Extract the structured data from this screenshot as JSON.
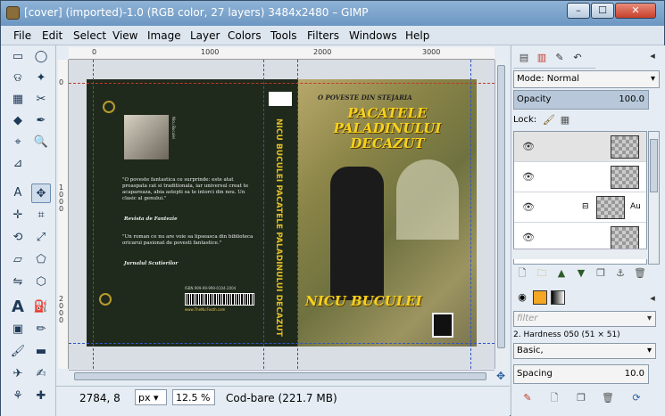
{
  "window": {
    "title": "[cover] (imported)-1.0 (RGB color, 27 layers) 3484x2480 – GIMP",
    "minimize_label": "–",
    "maximize_label": "☐",
    "close_label": "✕"
  },
  "menu": [
    "File",
    "Edit",
    "Select",
    "View",
    "Image",
    "Layer",
    "Colors",
    "Tools",
    "Filters",
    "Windows",
    "Help"
  ],
  "ruler": {
    "h_ticks": [
      "0",
      "1000",
      "2000",
      "3000"
    ],
    "v_ticks": [
      "0",
      "1000",
      "2000"
    ]
  },
  "cover": {
    "back_quote1": "\"O poveste fantastica ce surprinde: este atat proaspata cat si traditionala, iar universul creat te acapareaza, abia astepti sa te intorci din nou. Un clasic al genului.\"",
    "back_source1": "Revista de Fantezie",
    "back_quote2": "\"Un roman ce nu are voie sa lipseasca din biblioteca oricarui pasionat de povesti fantastice.\"",
    "back_source2": "Jurnalul Scutierilor",
    "photo_caption": "Nicu Buculei",
    "isbn": "ISBN 999-99-999-0104-2004",
    "barcode_caption": "www.TheNicFooth.com",
    "spine_title": "NICU BUCULEI   PACATELE PALADINULUI DECAZUT",
    "front_subtitle": "O POVESTE DIN STEJARIA",
    "front_title": "PACATELE PALADINULUI DECAZUT",
    "front_author": "NICU BUCULEI"
  },
  "status": {
    "coords": "2784, 8",
    "unit": "px",
    "zoom": "12.5 %",
    "message": "Cod-bare (221.7 MB)"
  },
  "layers_panel": {
    "mode_label": "Mode: Normal",
    "opacity_label": "Opacity",
    "opacity_value": "100.0",
    "lock_label": "Lock:",
    "layer_name_partial": "Au"
  },
  "brushes_panel": {
    "filter_placeholder": "filter",
    "brush_name": "2. Hardness 050 (51 × 51)",
    "preset": "Basic,",
    "spacing_label": "Spacing",
    "spacing_value": "10.0"
  }
}
